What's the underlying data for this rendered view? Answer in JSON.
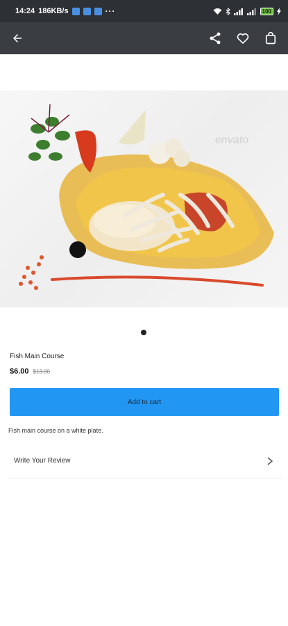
{
  "status_bar": {
    "time": "14:24",
    "speed": "186KB/s",
    "dots": "···",
    "battery": "100"
  },
  "product": {
    "title": "Fish Main Course",
    "price": "$6.00",
    "old_price": "$13.00",
    "add_to_cart_label": "Add to cart",
    "description": "Fish main course on a white plate.",
    "review_label": "Write Your Review",
    "image_watermark": "envato"
  },
  "icons": {
    "back": "arrow-back-icon",
    "share": "share-icon",
    "favorite": "heart-icon",
    "cart": "shopping-bag-icon",
    "review_chevron": "chevron-right-icon"
  },
  "colors": {
    "status_bar": "#2d3035",
    "app_bar": "#3a3d42",
    "primary_button": "#2196f3"
  }
}
